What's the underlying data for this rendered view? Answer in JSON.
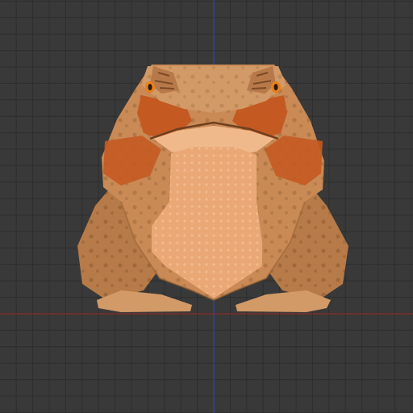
{
  "viewport": {
    "background_color": "#393939",
    "grid_color": "#2e2e2e",
    "x_axis_color": "#8a2b2b",
    "y_axis_color": "#3a3fa8"
  },
  "model": {
    "object": "horned-frog-icon",
    "colors": {
      "skin": "#c98a55",
      "skin_dark": "#9c6436",
      "belly": "#eba877",
      "orange_patch": "#c45a22",
      "eye": "#e8801a"
    }
  }
}
